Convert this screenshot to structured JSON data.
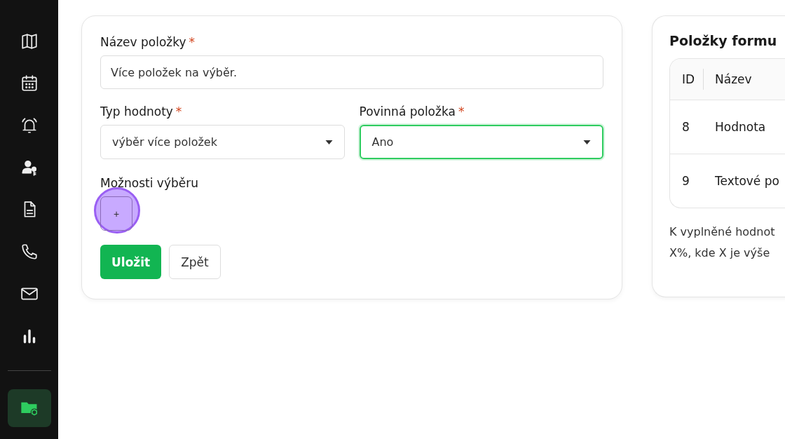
{
  "sidebar": {
    "items": [
      {
        "kind": "map",
        "selected": false
      },
      {
        "kind": "calendar",
        "selected": false
      },
      {
        "kind": "bell",
        "selected": false
      },
      {
        "kind": "user-key",
        "selected": false
      },
      {
        "kind": "document",
        "selected": false
      },
      {
        "kind": "phone",
        "selected": false
      },
      {
        "kind": "mail",
        "selected": false
      },
      {
        "kind": "chart",
        "selected": false
      }
    ],
    "bottom_item": {
      "kind": "folder",
      "selected": true
    }
  },
  "form": {
    "name_field": {
      "label": "Název položky",
      "required_mark": "*",
      "value": "Více položek na výběr."
    },
    "value_type": {
      "label": "Typ hodnoty",
      "required_mark": "*",
      "value": "výběr více položek",
      "focused": false
    },
    "mandatory": {
      "label": "Povinná položka",
      "required_mark": "*",
      "value": "Ano",
      "focused": true
    },
    "options": {
      "label": "Možnosti výběru",
      "add_button": "+",
      "clicked": true
    },
    "buttons": [
      {
        "label": "Uložit",
        "kind": "primary"
      },
      {
        "label": "Zpět",
        "kind": "secondary"
      }
    ]
  },
  "side_panel": {
    "title": "Položky formu",
    "table": {
      "columns": [
        "ID",
        "Název"
      ],
      "rows": [
        [
          "8",
          "Hodnota"
        ],
        [
          "9",
          "Textové po"
        ]
      ]
    },
    "note_lines": [
      "K vyplněné hodnot",
      "X%, kde X je výše"
    ]
  }
}
